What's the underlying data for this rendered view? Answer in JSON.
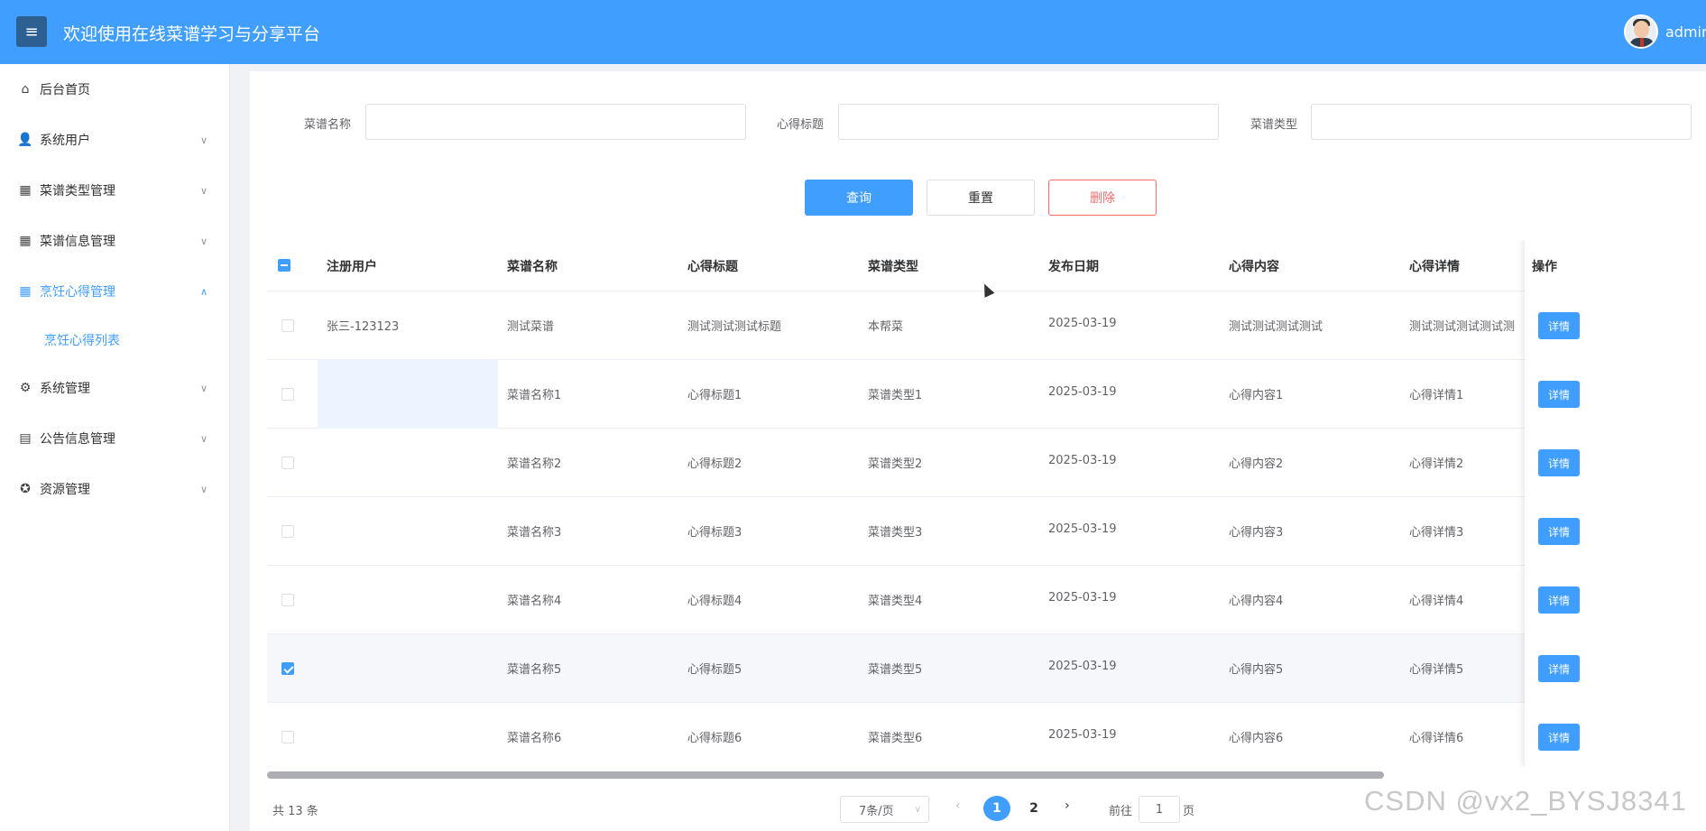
{
  "header": {
    "menu_icon": "menu-icon",
    "title": "欢迎使用在线菜谱学习与分享平台",
    "username": "admin",
    "color": "#409eff"
  },
  "sidebar": {
    "items": [
      {
        "label": "后台首页",
        "icon": "home-icon",
        "expandable": false
      },
      {
        "label": "系统用户",
        "icon": "user-icon",
        "expandable": true
      },
      {
        "label": "菜谱类型管理",
        "icon": "grid-icon",
        "expandable": true
      },
      {
        "label": "菜谱信息管理",
        "icon": "grid-icon",
        "expandable": true
      },
      {
        "label": "烹饪心得管理",
        "icon": "grid-icon",
        "expandable": true,
        "active": true
      },
      {
        "label": "系统管理",
        "icon": "gear-icon",
        "expandable": true
      },
      {
        "label": "公告信息管理",
        "icon": "document-icon",
        "expandable": true
      },
      {
        "label": "资源管理",
        "icon": "compass-icon",
        "expandable": true
      }
    ],
    "sub_item": "烹饪心得列表"
  },
  "search": {
    "fields": [
      {
        "label": "菜谱名称",
        "value": ""
      },
      {
        "label": "心得标题",
        "value": ""
      },
      {
        "label": "菜谱类型",
        "value": ""
      }
    ],
    "query_label": "查询",
    "reset_label": "重置",
    "delete_label": "删除"
  },
  "table": {
    "columns": [
      "注册用户",
      "菜谱名称",
      "心得标题",
      "菜谱类型",
      "发布日期",
      "心得内容",
      "心得详情",
      "操作"
    ],
    "detail_label": "详情",
    "rows": [
      {
        "user": "张三-123123",
        "name": "测试菜谱",
        "title": "测试测试测试标题",
        "type": "本帮菜",
        "date": "2025-03-19",
        "content": "测试测试测试测试",
        "detail": "测试测试测试测试测",
        "checked": false
      },
      {
        "user": "",
        "name": "菜谱名称1",
        "title": "心得标题1",
        "type": "菜谱类型1",
        "date": "2025-03-19",
        "content": "心得内容1",
        "detail": "心得详情1",
        "checked": false
      },
      {
        "user": "",
        "name": "菜谱名称2",
        "title": "心得标题2",
        "type": "菜谱类型2",
        "date": "2025-03-19",
        "content": "心得内容2",
        "detail": "心得详情2",
        "checked": false
      },
      {
        "user": "",
        "name": "菜谱名称3",
        "title": "心得标题3",
        "type": "菜谱类型3",
        "date": "2025-03-19",
        "content": "心得内容3",
        "detail": "心得详情3",
        "checked": false
      },
      {
        "user": "",
        "name": "菜谱名称4",
        "title": "心得标题4",
        "type": "菜谱类型4",
        "date": "2025-03-19",
        "content": "心得内容4",
        "detail": "心得详情4",
        "checked": false
      },
      {
        "user": "",
        "name": "菜谱名称5",
        "title": "心得标题5",
        "type": "菜谱类型5",
        "date": "2025-03-19",
        "content": "心得内容5",
        "detail": "心得详情5",
        "checked": true
      },
      {
        "user": "",
        "name": "菜谱名称6",
        "title": "心得标题6",
        "type": "菜谱类型6",
        "date": "2025-03-19",
        "content": "心得内容6",
        "detail": "心得详情6",
        "checked": false
      }
    ]
  },
  "pagination": {
    "total": "共 13 条",
    "page_size": "7条/页",
    "pages": [
      "1",
      "2"
    ],
    "current": "1",
    "goto_label": "前往",
    "goto_value": "1",
    "page_label": "页"
  },
  "watermark": "CSDN @vx2_BYSJ8341"
}
